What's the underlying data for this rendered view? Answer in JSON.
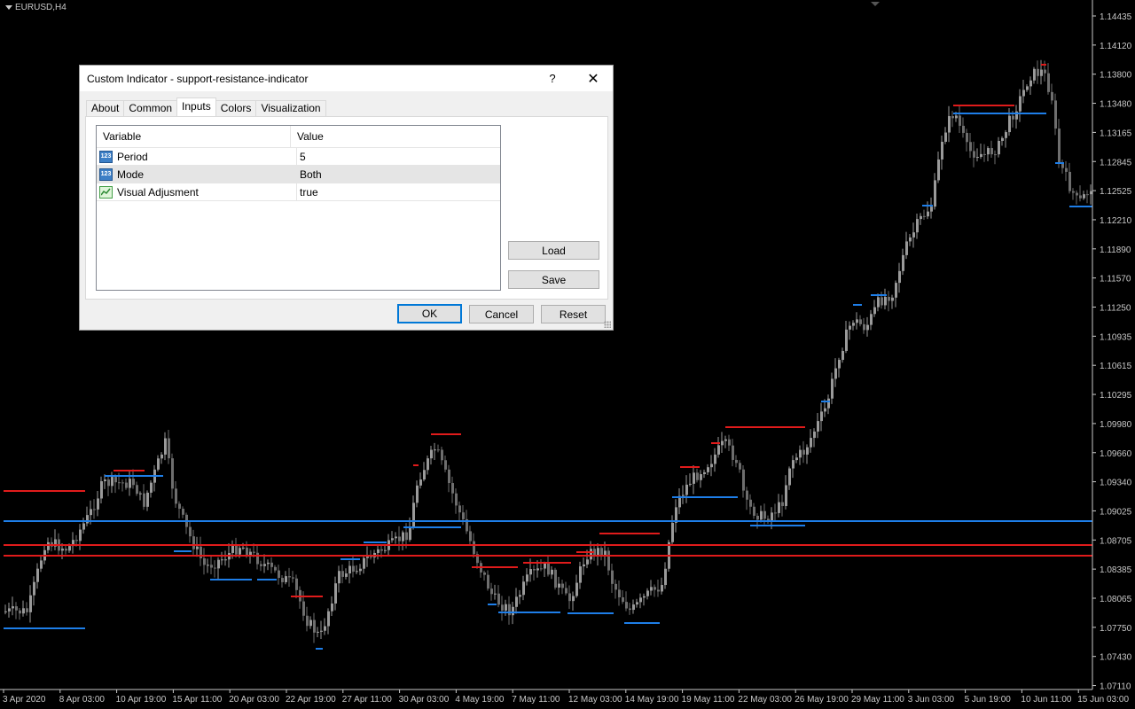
{
  "chart": {
    "symbol": "EURUSD,H4",
    "price_labels": [
      "1.14435",
      "1.14120",
      "1.13800",
      "1.13480",
      "1.13165",
      "1.12845",
      "1.12525",
      "1.12210",
      "1.11890",
      "1.11570",
      "1.11250",
      "1.10935",
      "1.10615",
      "1.10295",
      "1.09980",
      "1.09660",
      "1.09340",
      "1.09025",
      "1.08705",
      "1.08385",
      "1.08065",
      "1.07750",
      "1.07430",
      "1.07110"
    ],
    "time_labels": [
      "3 Apr 2020",
      "8 Apr 03:00",
      "10 Apr 19:00",
      "15 Apr 11:00",
      "20 Apr 03:00",
      "22 Apr 19:00",
      "27 Apr 11:00",
      "30 Apr 03:00",
      "4 May 19:00",
      "7 May 11:00",
      "12 May 03:00",
      "14 May 19:00",
      "19 May 11:00",
      "22 May 03:00",
      "26 May 19:00",
      "29 May 11:00",
      "3 Jun 03:00",
      "5 Jun 19:00",
      "10 Jun 11:00",
      "15 Jun 03:00"
    ],
    "colors": {
      "bull": "#9a9a9a",
      "bear": "#6e6e6e",
      "support": "#1e7ee8",
      "resistance": "#e01b1b",
      "axis_text": "#c8c8c8"
    }
  },
  "dialog": {
    "title": "Custom Indicator - support-resistance-indicator",
    "help_label": "?",
    "close_label": "✕",
    "tabs": [
      {
        "label": "About"
      },
      {
        "label": "Common"
      },
      {
        "label": "Inputs"
      },
      {
        "label": "Colors"
      },
      {
        "label": "Visualization"
      }
    ],
    "active_tab": "Inputs",
    "grid": {
      "header_variable": "Variable",
      "header_value": "Value",
      "rows": [
        {
          "variable": "Period",
          "value": "5",
          "icon": "number-icon"
        },
        {
          "variable": "Mode",
          "value": "Both",
          "icon": "number-icon"
        },
        {
          "variable": "Visual Adjusment",
          "value": "true",
          "icon": "adjust-icon"
        }
      ]
    },
    "icon_text": "123",
    "buttons": {
      "load": "Load",
      "save": "Save",
      "ok": "OK",
      "cancel": "Cancel",
      "reset": "Reset"
    }
  }
}
